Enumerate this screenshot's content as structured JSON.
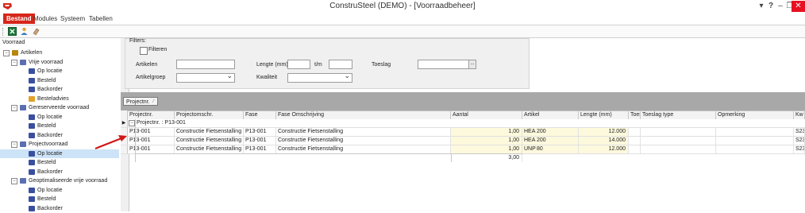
{
  "window": {
    "title": "ConstruSteel (DEMO) - [Voorraadbeheer]"
  },
  "menu": [
    "Bestand",
    "Modules",
    "Systeem",
    "Tabellen"
  ],
  "titlebar_icons": {
    "dropdown": "▾",
    "help": "?",
    "minimize": "–",
    "restore": "❐",
    "close": "✕"
  },
  "toolbar": {
    "icons": [
      "excel-export-icon",
      "user-icon",
      "eraser-icon"
    ]
  },
  "tree": {
    "title": "Voorraad",
    "items": [
      {
        "label": "Artikelen",
        "level": 0
      },
      {
        "label": "Vrije voorraad",
        "level": 1
      },
      {
        "label": "Op locatie",
        "level": 2
      },
      {
        "label": "Besteld",
        "level": 2
      },
      {
        "label": "Backorder",
        "level": 2
      },
      {
        "label": "Besteladvies",
        "level": 2
      },
      {
        "label": "Gereserveerde voorraad",
        "level": 1
      },
      {
        "label": "Op locatie",
        "level": 2
      },
      {
        "label": "Besteld",
        "level": 2
      },
      {
        "label": "Backorder",
        "level": 2
      },
      {
        "label": "Projectvoorraad",
        "level": 1
      },
      {
        "label": "Op locatie",
        "level": 2,
        "selected": true
      },
      {
        "label": "Besteld",
        "level": 2
      },
      {
        "label": "Backorder",
        "level": 2
      },
      {
        "label": "Geoptimaliseerde vrije voorraad",
        "level": 1
      },
      {
        "label": "Op locatie",
        "level": 2
      },
      {
        "label": "Besteld",
        "level": 2
      },
      {
        "label": "Backorder",
        "level": 2
      }
    ]
  },
  "filters": {
    "title": "Filters:",
    "filter_checkbox": "Filteren",
    "artikelen_label": "Artikelen",
    "artikelgroep_label": "Artikelgroep",
    "lengte_label": "Lengte (mm)",
    "tm_label": "t/m",
    "kwaliteit_label": "Kwaliteit",
    "toeslag_label": "Toeslag",
    "browse_label": "..."
  },
  "grid": {
    "group_chip": "Projectnr.",
    "columns": [
      "Projectnr.",
      "Projectomschr.",
      "Fase",
      "Fase Omschrijving",
      "Aantal",
      "Artikel",
      "Lengte (mm)",
      "Toeslag",
      "Toeslag type",
      "Opmerking",
      "Kw"
    ],
    "group_row": "Projectnr. : P13-001",
    "rows": [
      {
        "projectnr": "P13-001",
        "projectomschr": "Constructie Fietsenstalling",
        "fase": "P13-001",
        "fase_omschrijving": "Constructie Fietsenstalling",
        "aantal": "1,00",
        "artikel_type": "HEA",
        "artikel_size": "200",
        "lengte": "12.000",
        "kw": "S23"
      },
      {
        "projectnr": "P13-001",
        "projectomschr": "Constructie Fietsenstalling",
        "fase": "P13-001",
        "fase_omschrijving": "Constructie Fietsenstalling",
        "aantal": "1,00",
        "artikel_type": "HEA",
        "artikel_size": "200",
        "lengte": "14.000",
        "kw": "S23"
      },
      {
        "projectnr": "P13-001",
        "projectomschr": "Constructie Fietsenstalling",
        "fase": "P13-001",
        "fase_omschrijving": "Constructie Fietsenstalling",
        "aantal": "1,00",
        "artikel_type": "UNP",
        "artikel_size": "80",
        "lengte": "12.000",
        "kw": "S23"
      }
    ],
    "total": "3,00"
  },
  "colors": {
    "accent_red": "#d6261a",
    "highlight": "#fdf9dd",
    "selection": "#cde3f7"
  }
}
